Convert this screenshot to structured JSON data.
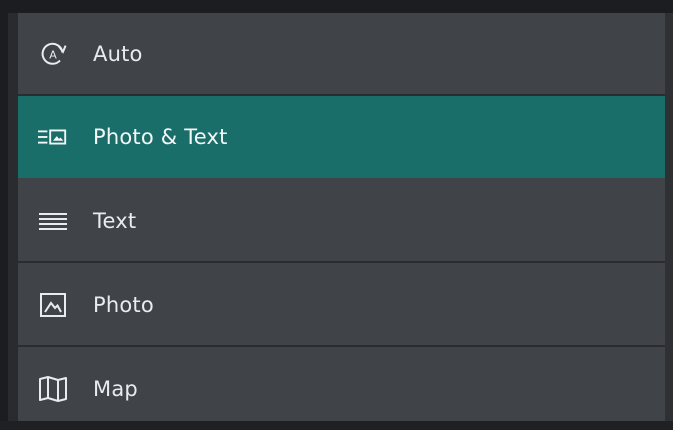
{
  "menu": {
    "items": [
      {
        "label": "Auto",
        "icon": "auto-rotate-icon"
      },
      {
        "label": "Photo & Text",
        "icon": "photo-text-icon"
      },
      {
        "label": "Text",
        "icon": "text-lines-icon"
      },
      {
        "label": "Photo",
        "icon": "photo-icon"
      },
      {
        "label": "Map",
        "icon": "map-icon"
      }
    ],
    "selected_index": 1
  },
  "colors": {
    "background": "#404348",
    "selected": "#1a6e6a",
    "text": "#e9ecef"
  }
}
